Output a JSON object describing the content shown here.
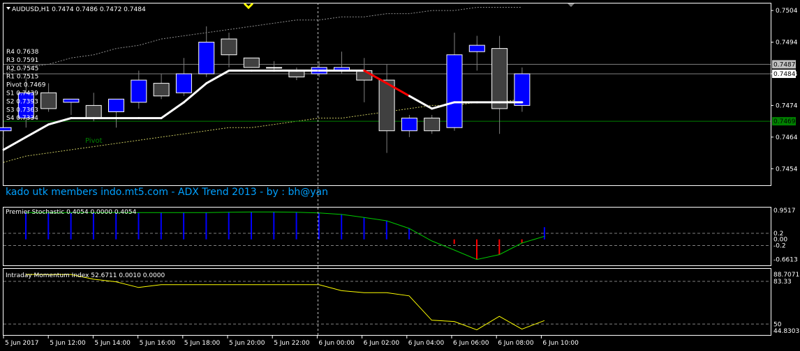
{
  "symbol_header": "AUDUSD,H1  0.7474 0.7486 0.7472 0.7484",
  "watermark": "kado utk members indo.mt5.com - ADX Trend 2013 - by : bh@yan",
  "pivot_tag": "Pivot",
  "pivot_levels": [
    {
      "label": "R4 0.7638"
    },
    {
      "label": "R3 0.7591"
    },
    {
      "label": "R2 0.7545"
    },
    {
      "label": "R1 0.7515"
    },
    {
      "label": "Pivot 0.7469"
    },
    {
      "label": "S1 0.7439"
    },
    {
      "label": "S2 0.7393"
    },
    {
      "label": "S3 0.7363"
    },
    {
      "label": "S4 0.7334"
    }
  ],
  "colors": {
    "bull": "#0000ff",
    "bear": "#404040",
    "pivot": "#008000",
    "trend": "#ffffff",
    "trend_down": "#ff0000",
    "stoch": "#00cc00",
    "imi": "#ffff00",
    "grid": "#808080"
  },
  "chart_data": [
    {
      "type": "candlestick",
      "title": "AUDUSD,H1",
      "ylim": [
        0.7449,
        0.7506
      ],
      "yticks": [
        "0.7504",
        "0.7494",
        "0.7484",
        "0.7474",
        "0.7464",
        "0.7454"
      ],
      "price_tags": [
        {
          "label": "0.7487",
          "value": 0.7487,
          "bg": "#c0c0c0",
          "fg": "#000000"
        },
        {
          "label": "0.7484",
          "value": 0.7484,
          "bg": "#ffffff",
          "fg": "#000000"
        },
        {
          "label": "0.7469",
          "value": 0.7469,
          "bg": "#008000",
          "fg": "#000000"
        }
      ],
      "horizontal_lines": [
        {
          "name": "R1",
          "value": 0.7487,
          "color": "#808080"
        },
        {
          "name": "Close",
          "value": 0.7484,
          "color": "#808080"
        },
        {
          "name": "Pivot",
          "value": 0.7469,
          "color": "#008000"
        }
      ],
      "candles": [
        {
          "o": 0.7466,
          "h": 0.7467,
          "l": 0.7464,
          "c": 0.7467
        },
        {
          "o": 0.747,
          "h": 0.7483,
          "l": 0.7467,
          "c": 0.7478
        },
        {
          "o": 0.7478,
          "h": 0.7481,
          "l": 0.7472,
          "c": 0.7473
        },
        {
          "o": 0.7475,
          "h": 0.7476,
          "l": 0.7471,
          "c": 0.7476
        },
        {
          "o": 0.7474,
          "h": 0.7478,
          "l": 0.7469,
          "c": 0.747
        },
        {
          "o": 0.7472,
          "h": 0.7476,
          "l": 0.7467,
          "c": 0.7476
        },
        {
          "o": 0.7475,
          "h": 0.7485,
          "l": 0.7473,
          "c": 0.7482
        },
        {
          "o": 0.7481,
          "h": 0.7484,
          "l": 0.7476,
          "c": 0.7477
        },
        {
          "o": 0.7478,
          "h": 0.7489,
          "l": 0.7477,
          "c": 0.7484
        },
        {
          "o": 0.7484,
          "h": 0.7499,
          "l": 0.7483,
          "c": 0.7494
        },
        {
          "o": 0.7495,
          "h": 0.7497,
          "l": 0.7486,
          "c": 0.749
        },
        {
          "o": 0.7489,
          "h": 0.7489,
          "l": 0.7486,
          "c": 0.7486
        },
        {
          "o": 0.7486,
          "h": 0.7488,
          "l": 0.7485,
          "c": 0.7486
        },
        {
          "o": 0.7485,
          "h": 0.7486,
          "l": 0.7482,
          "c": 0.7483
        },
        {
          "o": 0.7484,
          "h": 0.7488,
          "l": 0.7483,
          "c": 0.7486
        },
        {
          "o": 0.7485,
          "h": 0.7491,
          "l": 0.7484,
          "c": 0.7486
        },
        {
          "o": 0.7485,
          "h": 0.7489,
          "l": 0.7475,
          "c": 0.7482
        },
        {
          "o": 0.7482,
          "h": 0.7487,
          "l": 0.7459,
          "c": 0.7466
        },
        {
          "o": 0.7466,
          "h": 0.7471,
          "l": 0.7464,
          "c": 0.747
        },
        {
          "o": 0.747,
          "h": 0.7471,
          "l": 0.7465,
          "c": 0.7466
        },
        {
          "o": 0.7467,
          "h": 0.7497,
          "l": 0.7466,
          "c": 0.749
        },
        {
          "o": 0.7491,
          "h": 0.7496,
          "l": 0.7485,
          "c": 0.7493
        },
        {
          "o": 0.7492,
          "h": 0.7496,
          "l": 0.7465,
          "c": 0.7473
        },
        {
          "o": 0.7474,
          "h": 0.7486,
          "l": 0.7472,
          "c": 0.7484
        }
      ],
      "trend_line": [
        0.746,
        0.7464,
        0.7468,
        0.747,
        0.747,
        0.747,
        0.747,
        0.747,
        0.7475,
        0.7481,
        0.7485,
        0.7485,
        0.7485,
        0.7485,
        0.7485,
        0.7485,
        0.7485,
        0.7481,
        0.7477,
        0.7473,
        0.7475,
        0.7475,
        0.7475,
        0.7475
      ],
      "trend_colors": [
        "w",
        "w",
        "w",
        "w",
        "w",
        "w",
        "w",
        "w",
        "w",
        "w",
        "w",
        "w",
        "w",
        "w",
        "w",
        "w",
        "w",
        "r",
        "r",
        "w",
        "w",
        "w",
        "w",
        "w"
      ],
      "band_upper": [
        0.7484,
        0.7486,
        0.7487,
        0.7489,
        0.749,
        0.7492,
        0.7493,
        0.7495,
        0.7496,
        0.7497,
        0.7498,
        0.7499,
        0.75,
        0.7501,
        0.7501,
        0.7502,
        0.7502,
        0.7503,
        0.7503,
        0.7504,
        0.7504,
        0.7505,
        0.7505,
        0.7505
      ],
      "band_lower": [
        0.7456,
        0.7458,
        0.7459,
        0.746,
        0.7461,
        0.7462,
        0.7463,
        0.7464,
        0.7465,
        0.7466,
        0.7467,
        0.7467,
        0.7468,
        0.7469,
        0.747,
        0.747,
        0.7471,
        0.7472,
        0.7473,
        0.7474,
        0.7474,
        0.7475,
        0.7475,
        0.7476
      ]
    },
    {
      "type": "histogram",
      "title": "Premier Stochastic 0.4054 0.0000 0.4054",
      "ylim": [
        -0.83,
        1.0
      ],
      "yticks": [
        "0.9517",
        "0.2",
        "0.00",
        "-0.2",
        "-0.6613"
      ],
      "levels": [
        0.2,
        -0.2
      ],
      "line": [
        0.88,
        0.88,
        0.88,
        0.88,
        0.88,
        0.88,
        0.88,
        0.88,
        0.88,
        0.89,
        0.9,
        0.9,
        0.89,
        0.87,
        0.82,
        0.72,
        0.61,
        0.36,
        -0.05,
        -0.35,
        -0.66,
        -0.5,
        -0.12,
        0.1
      ],
      "bars": [
        0.88,
        0.88,
        0.88,
        0.88,
        0.88,
        0.88,
        0.88,
        0.88,
        0.88,
        0.89,
        0.9,
        0.9,
        0.89,
        0.87,
        0.82,
        0.72,
        0.61,
        0.36,
        0.0,
        -0.15,
        -0.66,
        -0.5,
        -0.12,
        0.4
      ]
    },
    {
      "type": "line",
      "title": "Intraday Momentum Index 52.6711 0.0010 0.0000",
      "ylim": [
        42,
        92
      ],
      "yticks": [
        "88.7071",
        "83.33",
        "50",
        "44.8303"
      ],
      "levels": [
        83.33,
        50
      ],
      "values": [
        88.7,
        88.7,
        88.7,
        85.0,
        83.0,
        78.5,
        80.7,
        80.7,
        80.7,
        80.7,
        80.7,
        80.7,
        80.7,
        80.7,
        76.0,
        74.5,
        74.5,
        72.0,
        53.0,
        52.0,
        45.5,
        56.0,
        46.0,
        52.7
      ]
    }
  ],
  "x_labels": [
    "5 Jun 2017",
    "5 Jun 12:00",
    "5 Jun 14:00",
    "5 Jun 16:00",
    "5 Jun 18:00",
    "5 Jun 20:00",
    "5 Jun 22:00",
    "6 Jun 00:00",
    "6 Jun 02:00",
    "6 Jun 04:00",
    "6 Jun 06:00",
    "6 Jun 08:00",
    "6 Jun 10:00"
  ]
}
